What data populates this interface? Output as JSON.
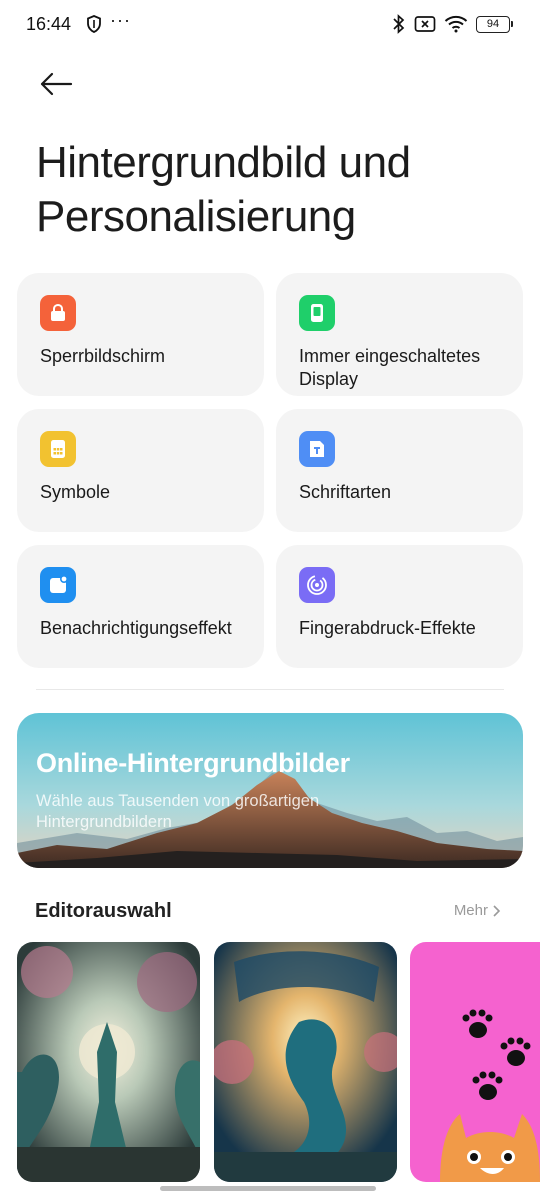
{
  "status_bar": {
    "time": "16:44",
    "dots": "···",
    "battery": "94"
  },
  "header": {
    "title": "Hintergrundbild und Personalisierung"
  },
  "tiles": [
    {
      "label": "Sperrbildschirm",
      "icon": "lock-icon",
      "color": "#f4623a"
    },
    {
      "label": "Immer eingeschaltetes Display",
      "icon": "phone-display-icon",
      "color": "#1fcf6a"
    },
    {
      "label": "Symbole",
      "icon": "app-grid-icon",
      "color": "#f2c230"
    },
    {
      "label": "Schriftarten",
      "icon": "font-icon",
      "color": "#4f8ef5"
    },
    {
      "label": "Benachrichtigungseffekt",
      "icon": "notification-icon",
      "color": "#1f8ff0"
    },
    {
      "label": "Fingerabdruck-Effekte",
      "icon": "fingerprint-icon",
      "color": "#7a6cf5"
    }
  ],
  "banner": {
    "title": "Online-Hintergrundbilder",
    "subtitle": "Wähle aus Tausenden von großartigen Hintergrundbildern"
  },
  "editor_section": {
    "title": "Editorauswahl",
    "more": "Mehr"
  }
}
